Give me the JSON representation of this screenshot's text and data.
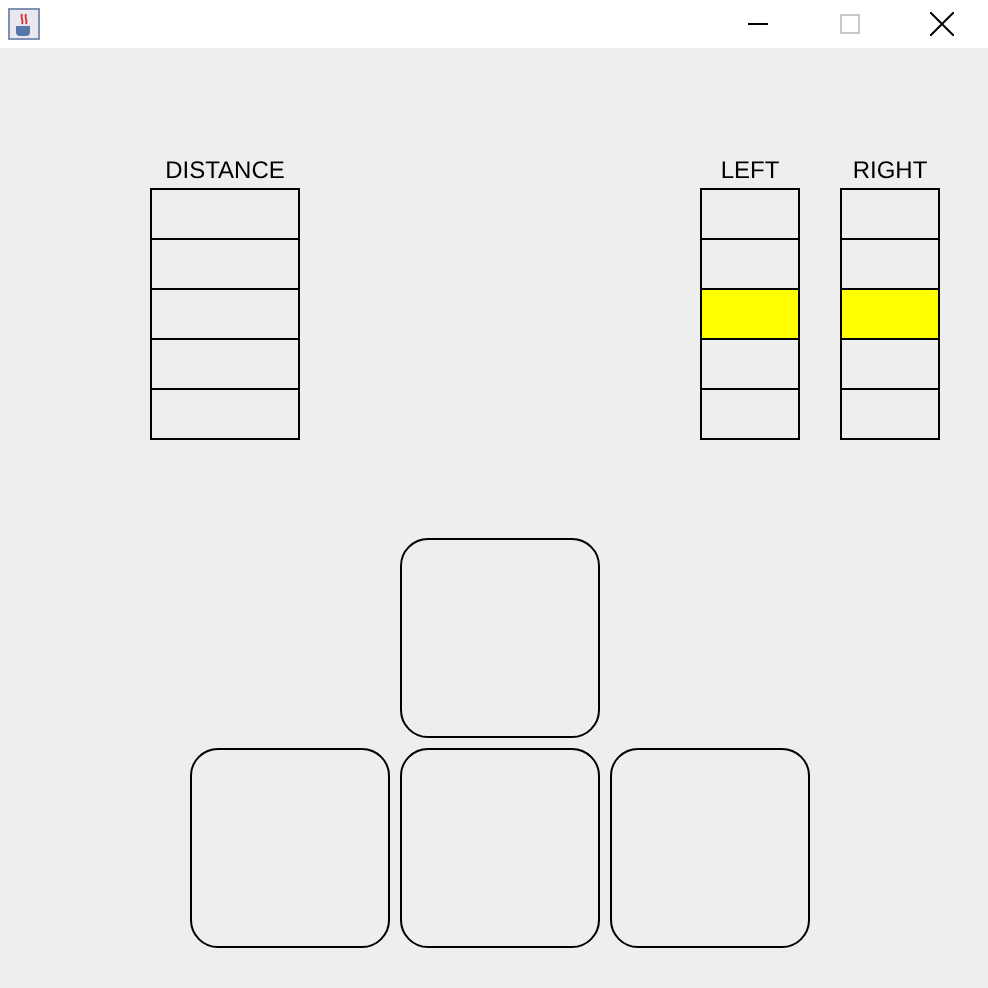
{
  "window": {
    "maximize_disabled": true
  },
  "meters": [
    {
      "label": "DISTANCE",
      "cells": [
        {
          "on": false
        },
        {
          "on": false
        },
        {
          "on": false
        },
        {
          "on": false
        },
        {
          "on": false
        }
      ]
    },
    {
      "label": "LEFT",
      "cells": [
        {
          "on": false
        },
        {
          "on": false
        },
        {
          "on": true
        },
        {
          "on": false
        },
        {
          "on": false
        }
      ]
    },
    {
      "label": "RIGHT",
      "cells": [
        {
          "on": false
        },
        {
          "on": false
        },
        {
          "on": true
        },
        {
          "on": false
        },
        {
          "on": false
        }
      ]
    }
  ],
  "keys": [
    {
      "pressed": false
    },
    {
      "pressed": false
    },
    {
      "pressed": false
    },
    {
      "pressed": false
    }
  ]
}
